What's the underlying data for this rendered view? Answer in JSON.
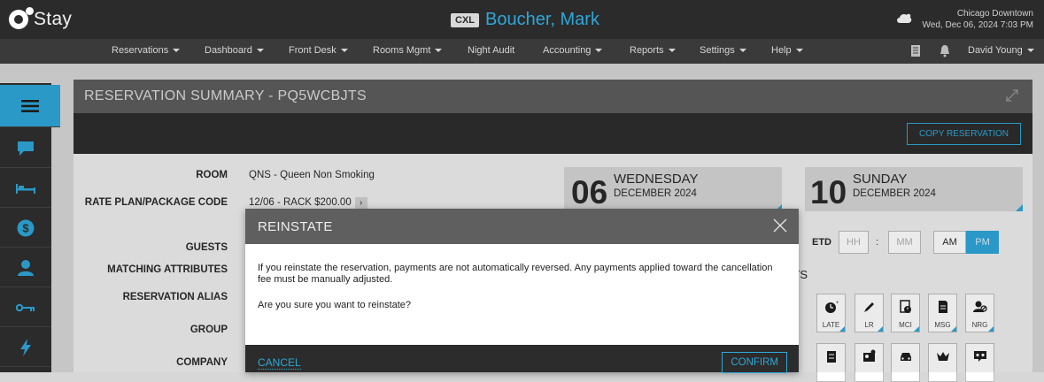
{
  "app": {
    "logo_text": "Stay"
  },
  "header": {
    "status_badge": "CXL",
    "guest_name": "Boucher, Mark",
    "location": "Chicago Downtown",
    "datetime": "Wed, Dec 06, 2024 7:03 PM"
  },
  "nav": {
    "items": [
      "Reservations",
      "Dashboard",
      "Front Desk",
      "Rooms Mgmt",
      "Night Audit",
      "Accounting",
      "Reports",
      "Settings",
      "Help"
    ],
    "user": "David Young"
  },
  "sidebar": {
    "icons": [
      "menu-icon",
      "chat-icon",
      "bed-icon",
      "dollar-icon",
      "person-icon",
      "key-icon",
      "lightning-icon"
    ]
  },
  "panel": {
    "title": "RESERVATION SUMMARY - PQ5WCBJTS",
    "copy_label": "COPY RESERVATION",
    "fields": {
      "room_label": "ROOM",
      "room_value": "QNS - Queen Non Smoking",
      "rate_label": "RATE PLAN/PACKAGE CODE",
      "rate_value": "12/06 - RACK $200.00",
      "guests_label": "GUESTS",
      "matching_label": "MATCHING ATTRIBUTES",
      "alias_label": "RESERVATION ALIAS",
      "group_label": "GROUP",
      "company_label": "COMPANY"
    },
    "arrival": {
      "day": "06",
      "weekday": "WEDNESDAY",
      "month": "DECEMBER 2024"
    },
    "departure": {
      "day": "10",
      "weekday": "SUNDAY",
      "month": "DECEMBER 2024"
    },
    "etd": {
      "label": "ETD",
      "hh": "HH",
      "sep": ":",
      "mm": "MM",
      "am": "AM",
      "pm": "PM"
    },
    "flags_fragment": "HTS",
    "flags_row1": [
      "LATE",
      "LR",
      "MCI",
      "MSG",
      "NRG"
    ],
    "flags_row2": [
      "VIP",
      "VM"
    ]
  },
  "modal": {
    "title": "REINSTATE",
    "message": "If you reinstate the reservation, payments are not automatically reversed. Any payments applied toward the cancellation fee must be manually adjusted.",
    "question": "Are you sure you want to reinstate?",
    "cancel_label": "CANCEL",
    "confirm_label": "CONFIRM"
  },
  "colors": {
    "accent": "#2ea7d8",
    "topbar": "#2b2b2b",
    "panel_head": "#5d5d5d"
  }
}
